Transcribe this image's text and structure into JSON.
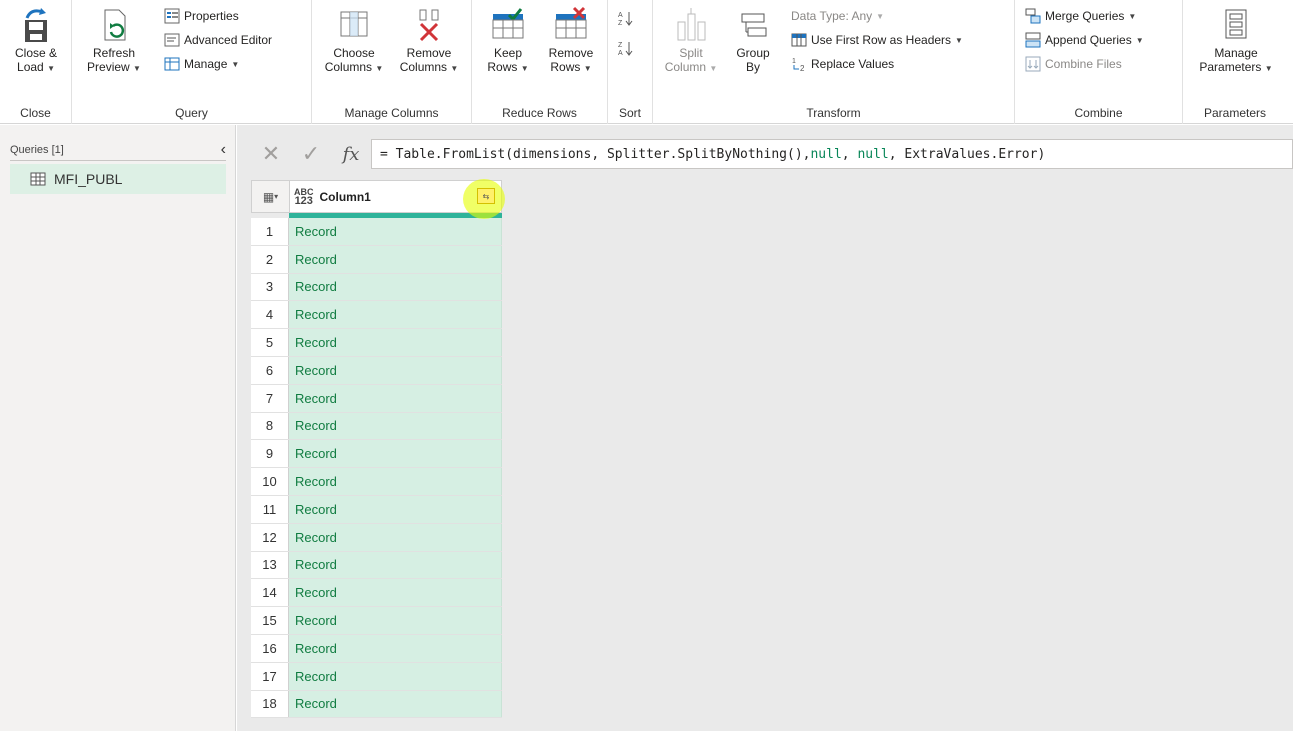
{
  "ribbon": {
    "close": {
      "close_load": "Close &",
      "close_load2": "Load",
      "label": "Close"
    },
    "query": {
      "refresh": "Refresh",
      "refresh2": "Preview",
      "properties": "Properties",
      "advanced_editor": "Advanced Editor",
      "manage": "Manage",
      "label": "Query"
    },
    "manage_columns": {
      "choose": "Choose",
      "choose2": "Columns",
      "remove": "Remove",
      "remove2": "Columns",
      "label": "Manage Columns"
    },
    "reduce_rows": {
      "keep": "Keep",
      "keep2": "Rows",
      "remove": "Remove",
      "remove2": "Rows",
      "label": "Reduce Rows"
    },
    "sort": {
      "label": "Sort"
    },
    "transform": {
      "split": "Split",
      "split2": "Column",
      "group": "Group",
      "group2": "By",
      "data_type": "Data Type: Any",
      "first_row": "Use First Row as Headers",
      "replace": "Replace Values",
      "label": "Transform"
    },
    "combine": {
      "merge": "Merge Queries",
      "append": "Append Queries",
      "combine_files": "Combine Files",
      "label": "Combine"
    },
    "parameters": {
      "manage": "Manage",
      "manage2": "Parameters",
      "label": "Parameters"
    }
  },
  "left_pane": {
    "header": "Queries [1]",
    "items": [
      {
        "label": "MFI_PUBL"
      }
    ]
  },
  "formula": {
    "text_prefix": "= Table.FromList(dimensions, Splitter.SplitByNothing(), ",
    "null1": "null",
    "sep": ", ",
    "null2": "null",
    "text_suffix": ", ExtraValues.Error)"
  },
  "grid": {
    "type_abc": "ABC",
    "type_123": "123",
    "column": "Column1",
    "rows": [
      {
        "n": "1",
        "v": "Record"
      },
      {
        "n": "2",
        "v": "Record"
      },
      {
        "n": "3",
        "v": "Record"
      },
      {
        "n": "4",
        "v": "Record"
      },
      {
        "n": "5",
        "v": "Record"
      },
      {
        "n": "6",
        "v": "Record"
      },
      {
        "n": "7",
        "v": "Record"
      },
      {
        "n": "8",
        "v": "Record"
      },
      {
        "n": "9",
        "v": "Record"
      },
      {
        "n": "10",
        "v": "Record"
      },
      {
        "n": "11",
        "v": "Record"
      },
      {
        "n": "12",
        "v": "Record"
      },
      {
        "n": "13",
        "v": "Record"
      },
      {
        "n": "14",
        "v": "Record"
      },
      {
        "n": "15",
        "v": "Record"
      },
      {
        "n": "16",
        "v": "Record"
      },
      {
        "n": "17",
        "v": "Record"
      },
      {
        "n": "18",
        "v": "Record"
      }
    ]
  },
  "colors": {
    "accent": "#2eb39a",
    "record_bg": "#d6efe3",
    "record_text": "#107c41",
    "highlight": "#e6ff00"
  }
}
